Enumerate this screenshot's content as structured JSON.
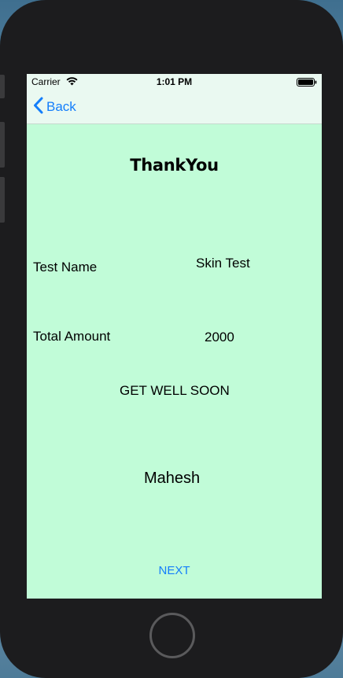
{
  "status_bar": {
    "carrier": "Carrier",
    "time": "1:01 PM"
  },
  "nav": {
    "back_label": "Back"
  },
  "page": {
    "title": "ThankYou",
    "test_name_label": "Test Name",
    "test_name_value": "Skin Test",
    "total_amount_label": "Total Amount",
    "total_amount_value": "2000",
    "message": "GET WELL SOON",
    "patient_name": "Mahesh",
    "next_label": "NEXT"
  },
  "colors": {
    "background": "#c1fcd8",
    "bar_background": "#eaf9f1",
    "accent": "#147efb"
  }
}
